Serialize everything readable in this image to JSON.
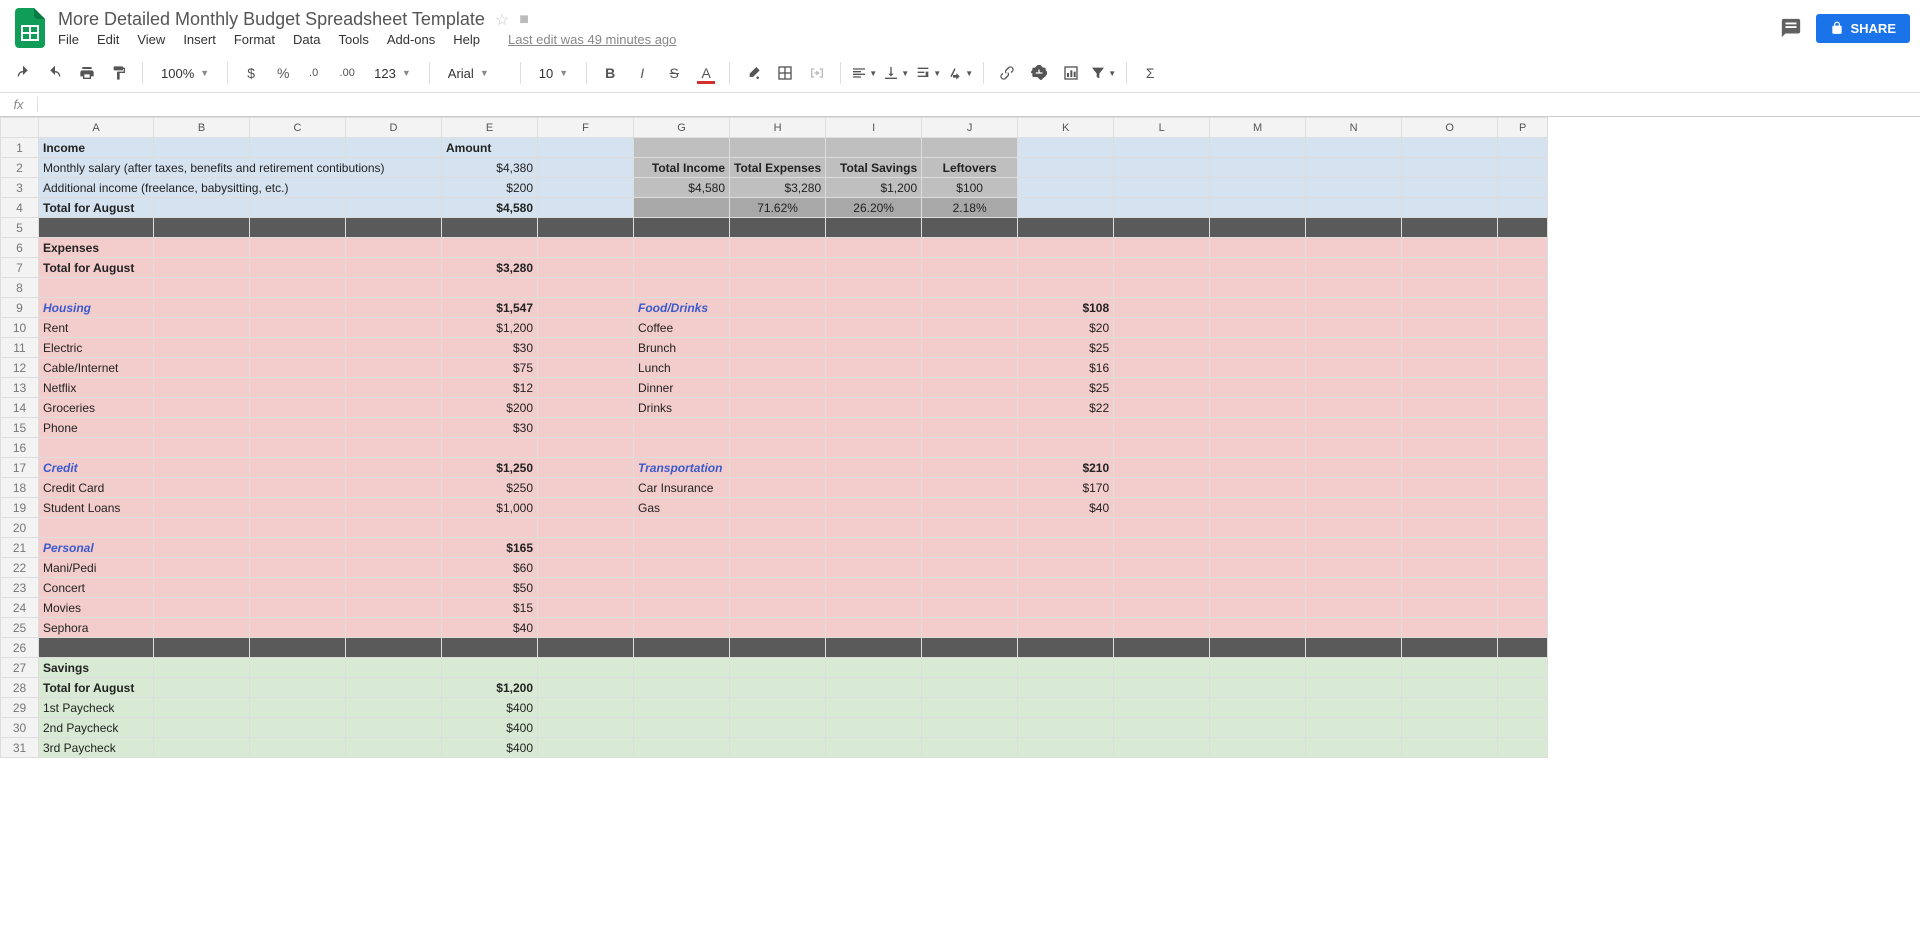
{
  "doc": {
    "title": "More Detailed Monthly Budget Spreadsheet Template",
    "last_edit": "Last edit was 49 minutes ago"
  },
  "menus": [
    "File",
    "Edit",
    "View",
    "Insert",
    "Format",
    "Data",
    "Tools",
    "Add-ons",
    "Help"
  ],
  "toolbar": {
    "zoom": "100%",
    "font": "Arial",
    "font_size": "10",
    "fmt123": "123"
  },
  "share_label": "SHARE",
  "columns": [
    "A",
    "B",
    "C",
    "D",
    "E",
    "F",
    "G",
    "H",
    "I",
    "J",
    "K",
    "L",
    "M",
    "N",
    "O",
    "P"
  ],
  "rows": [
    {
      "n": 1,
      "bg": "bg-blue",
      "cells": {
        "A": {
          "v": "Income",
          "cls": "b"
        },
        "E": {
          "v": "Amount",
          "cls": "b"
        },
        "G": {
          "bg": "bg-gray"
        },
        "H": {
          "bg": "bg-gray"
        },
        "I": {
          "bg": "bg-gray"
        },
        "J": {
          "bg": "bg-gray"
        }
      }
    },
    {
      "n": 2,
      "bg": "bg-blue",
      "cells": {
        "A": {
          "v": "Monthly salary (after taxes, benefits and retirement contibutions)",
          "span": 4
        },
        "E": {
          "v": "$4,380",
          "cls": "r"
        },
        "G": {
          "v": "Total Income",
          "cls": "b r",
          "bg": "bg-gray"
        },
        "H": {
          "v": "Total Expenses",
          "cls": "b r",
          "bg": "bg-gray"
        },
        "I": {
          "v": "Total Savings",
          "cls": "b r",
          "bg": "bg-gray"
        },
        "J": {
          "v": "Leftovers",
          "cls": "b c",
          "bg": "bg-gray"
        }
      }
    },
    {
      "n": 3,
      "bg": "bg-blue",
      "cells": {
        "A": {
          "v": "Additional income (freelance, babysitting, etc.)",
          "span": 4
        },
        "E": {
          "v": "$200",
          "cls": "r"
        },
        "G": {
          "v": "$4,580",
          "cls": "r",
          "bg": "bg-gray"
        },
        "H": {
          "v": "$3,280",
          "cls": "r",
          "bg": "bg-gray"
        },
        "I": {
          "v": "$1,200",
          "cls": "r",
          "bg": "bg-gray"
        },
        "J": {
          "v": "$100",
          "cls": "c",
          "bg": "bg-gray"
        }
      }
    },
    {
      "n": 4,
      "bg": "bg-blue",
      "cells": {
        "A": {
          "v": "Total for August",
          "cls": "b"
        },
        "E": {
          "v": "$4,580",
          "cls": "b r"
        },
        "G": {
          "bg": "bg-graydk"
        },
        "H": {
          "v": "71.62%",
          "cls": "c",
          "bg": "bg-graydk"
        },
        "I": {
          "v": "26.20%",
          "cls": "c",
          "bg": "bg-graydk"
        },
        "J": {
          "v": "2.18%",
          "cls": "c",
          "bg": "bg-graydk"
        }
      }
    },
    {
      "n": 5,
      "bg": "bg-dark",
      "cells": {}
    },
    {
      "n": 6,
      "bg": "bg-pink",
      "cells": {
        "A": {
          "v": "Expenses",
          "cls": "b"
        }
      }
    },
    {
      "n": 7,
      "bg": "bg-pink",
      "cells": {
        "A": {
          "v": "Total for August",
          "cls": "b"
        },
        "E": {
          "v": "$3,280",
          "cls": "b r"
        }
      }
    },
    {
      "n": 8,
      "bg": "bg-pink",
      "cells": {}
    },
    {
      "n": 9,
      "bg": "bg-pink",
      "cells": {
        "A": {
          "v": "Housing",
          "cls": "cat"
        },
        "E": {
          "v": "$1,547",
          "cls": "b r"
        },
        "G": {
          "v": "Food/Drinks",
          "cls": "cat"
        },
        "K": {
          "v": "$108",
          "cls": "b r"
        }
      }
    },
    {
      "n": 10,
      "bg": "bg-pink",
      "cells": {
        "A": {
          "v": "Rent"
        },
        "E": {
          "v": "$1,200",
          "cls": "r"
        },
        "G": {
          "v": "Coffee"
        },
        "K": {
          "v": "$20",
          "cls": "r"
        }
      }
    },
    {
      "n": 11,
      "bg": "bg-pink",
      "cells": {
        "A": {
          "v": "Electric"
        },
        "E": {
          "v": "$30",
          "cls": "r"
        },
        "G": {
          "v": "Brunch"
        },
        "K": {
          "v": "$25",
          "cls": "r"
        }
      }
    },
    {
      "n": 12,
      "bg": "bg-pink",
      "cells": {
        "A": {
          "v": "Cable/Internet"
        },
        "E": {
          "v": "$75",
          "cls": "r"
        },
        "G": {
          "v": "Lunch"
        },
        "K": {
          "v": "$16",
          "cls": "r"
        }
      }
    },
    {
      "n": 13,
      "bg": "bg-pink",
      "cells": {
        "A": {
          "v": "Netflix"
        },
        "E": {
          "v": "$12",
          "cls": "r"
        },
        "G": {
          "v": "Dinner"
        },
        "K": {
          "v": "$25",
          "cls": "r"
        }
      }
    },
    {
      "n": 14,
      "bg": "bg-pink",
      "cells": {
        "A": {
          "v": "Groceries"
        },
        "E": {
          "v": "$200",
          "cls": "r"
        },
        "G": {
          "v": "Drinks"
        },
        "K": {
          "v": "$22",
          "cls": "r"
        }
      }
    },
    {
      "n": 15,
      "bg": "bg-pink",
      "cells": {
        "A": {
          "v": "Phone"
        },
        "E": {
          "v": "$30",
          "cls": "r"
        }
      }
    },
    {
      "n": 16,
      "bg": "bg-pink",
      "cells": {}
    },
    {
      "n": 17,
      "bg": "bg-pink",
      "cells": {
        "A": {
          "v": "Credit",
          "cls": "cat"
        },
        "E": {
          "v": "$1,250",
          "cls": "b r"
        },
        "G": {
          "v": "Transportation",
          "cls": "cat"
        },
        "K": {
          "v": "$210",
          "cls": "b r"
        }
      }
    },
    {
      "n": 18,
      "bg": "bg-pink",
      "cells": {
        "A": {
          "v": "Credit Card"
        },
        "E": {
          "v": "$250",
          "cls": "r"
        },
        "G": {
          "v": "Car Insurance"
        },
        "K": {
          "v": "$170",
          "cls": "r"
        }
      }
    },
    {
      "n": 19,
      "bg": "bg-pink",
      "cells": {
        "A": {
          "v": "Student Loans"
        },
        "E": {
          "v": "$1,000",
          "cls": "r"
        },
        "G": {
          "v": "Gas"
        },
        "K": {
          "v": "$40",
          "cls": "r"
        }
      }
    },
    {
      "n": 20,
      "bg": "bg-pink",
      "cells": {}
    },
    {
      "n": 21,
      "bg": "bg-pink",
      "cells": {
        "A": {
          "v": "Personal",
          "cls": "cat"
        },
        "E": {
          "v": "$165",
          "cls": "b r"
        }
      }
    },
    {
      "n": 22,
      "bg": "bg-pink",
      "cells": {
        "A": {
          "v": "Mani/Pedi"
        },
        "E": {
          "v": "$60",
          "cls": "r"
        }
      }
    },
    {
      "n": 23,
      "bg": "bg-pink",
      "cells": {
        "A": {
          "v": "Concert"
        },
        "E": {
          "v": "$50",
          "cls": "r"
        }
      }
    },
    {
      "n": 24,
      "bg": "bg-pink",
      "cells": {
        "A": {
          "v": "Movies"
        },
        "E": {
          "v": "$15",
          "cls": "r"
        }
      }
    },
    {
      "n": 25,
      "bg": "bg-pink",
      "cells": {
        "A": {
          "v": "Sephora"
        },
        "E": {
          "v": "$40",
          "cls": "r"
        }
      }
    },
    {
      "n": 26,
      "bg": "bg-dark",
      "cells": {}
    },
    {
      "n": 27,
      "bg": "bg-green",
      "cells": {
        "A": {
          "v": "Savings",
          "cls": "b"
        }
      }
    },
    {
      "n": 28,
      "bg": "bg-green",
      "cells": {
        "A": {
          "v": "Total for August",
          "cls": "b"
        },
        "E": {
          "v": "$1,200",
          "cls": "b r"
        }
      }
    },
    {
      "n": 29,
      "bg": "bg-green",
      "cells": {
        "A": {
          "v": "1st Paycheck"
        },
        "E": {
          "v": "$400",
          "cls": "r"
        }
      }
    },
    {
      "n": 30,
      "bg": "bg-green",
      "cells": {
        "A": {
          "v": "2nd Paycheck"
        },
        "E": {
          "v": "$400",
          "cls": "r"
        }
      }
    },
    {
      "n": 31,
      "bg": "bg-green",
      "cells": {
        "A": {
          "v": "3rd Paycheck"
        },
        "E": {
          "v": "$400",
          "cls": "r"
        }
      }
    }
  ]
}
